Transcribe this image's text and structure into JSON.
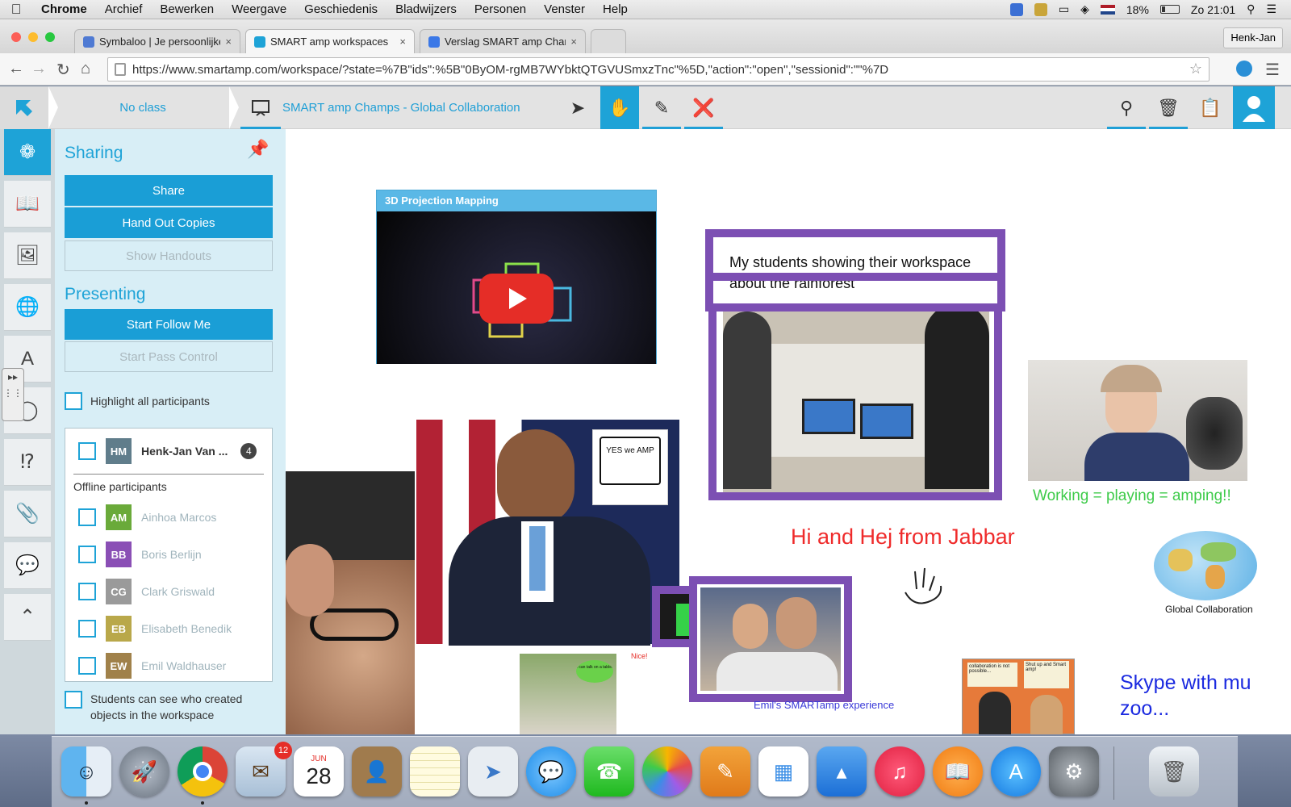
{
  "menubar": {
    "app": "Chrome",
    "items": [
      "Archief",
      "Bewerken",
      "Weergave",
      "Geschiedenis",
      "Bladwijzers",
      "Personen",
      "Venster",
      "Help"
    ],
    "battery": "18%",
    "clock": "Zo 21:01"
  },
  "browser": {
    "tabs": [
      {
        "title": "Symbaloo | Je persoonlijke",
        "close": "×"
      },
      {
        "title": "SMART amp workspaces",
        "close": "×"
      },
      {
        "title": "Verslag SMART amp Cham",
        "close": "×"
      }
    ],
    "profile": "Henk-Jan",
    "url": "https://www.smartamp.com/workspace/?state=%7B\"ids\":%5B\"0ByOM-rgMB7WYbktQTGVUSmxzTnc\"%5D,\"action\":\"open\",\"sessionid\":\"\"%7D"
  },
  "appbar": {
    "class": "No class",
    "workspace": "SMART amp Champs - Global Collaboration"
  },
  "panel": {
    "sharing_heading": "Sharing",
    "share": "Share",
    "hand_out": "Hand Out Copies",
    "show_handouts": "Show Handouts",
    "presenting_heading": "Presenting",
    "start_follow": "Start Follow Me",
    "start_pass": "Start Pass Control",
    "highlight": "Highlight all participants",
    "me": {
      "initials": "HM",
      "name": "Henk-Jan Van ...",
      "count": "4"
    },
    "offline_label": "Offline participants",
    "offline": [
      {
        "initials": "AM",
        "name": "Ainhoa Marcos",
        "color": "#6aaa3a"
      },
      {
        "initials": "BB",
        "name": "Boris Berlijn",
        "color": "#8a4fb5"
      },
      {
        "initials": "CG",
        "name": "Clark Griswald",
        "color": "#9a9a9a"
      },
      {
        "initials": "EB",
        "name": "Elisabeth Benedik",
        "color": "#b9a84a"
      },
      {
        "initials": "EW",
        "name": "Emil Waldhauser",
        "color": "#a0814a"
      }
    ],
    "students_see": "Students can see who created objects in the workspace"
  },
  "canvas": {
    "video_title": "3D Projection Mapping",
    "students_text": "My students showing their workspace about the rainforest",
    "yes_amp": "YES we AMP",
    "working": "Working = playing = amping!!",
    "hi_hej": "Hi and Hej from Jabbar",
    "global_collab": "Global Collaboration",
    "emils": "Emil's SMARTamp experience",
    "skype": "Skype with mu zoo...",
    "nice": "Nice!",
    "speech1": "I can talk on a tablet",
    "bubble_a": "collaboration is not possible...",
    "bubble_b": "Shut up and Smart amp!"
  },
  "dock": {
    "mail_badge": "12",
    "calendar_month": "JUN",
    "calendar_day": "28"
  }
}
